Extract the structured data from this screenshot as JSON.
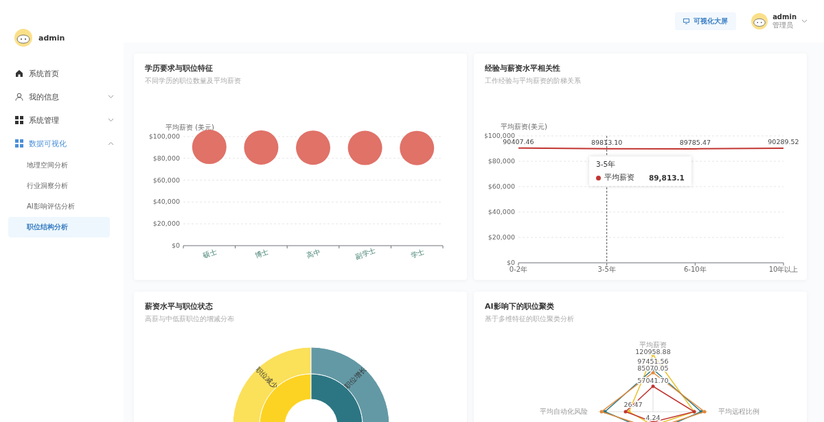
{
  "sidebar": {
    "user": "admin",
    "items": [
      {
        "label": "系统首页",
        "kind": "link",
        "selected": false
      },
      {
        "label": "我的信息",
        "kind": "group",
        "expanded": false,
        "selected": false
      },
      {
        "label": "系统管理",
        "kind": "group",
        "expanded": false,
        "selected": false
      },
      {
        "label": "数据可视化",
        "kind": "group",
        "expanded": true,
        "selected": true,
        "children": [
          {
            "label": "地理空间分析",
            "selected": false
          },
          {
            "label": "行业洞察分析",
            "selected": false
          },
          {
            "label": "AI影响评估分析",
            "selected": false
          },
          {
            "label": "职位结构分析",
            "selected": true
          }
        ]
      }
    ]
  },
  "header": {
    "screen_button": "可视化大屏",
    "user_name": "admin",
    "user_role": "管理员"
  },
  "cards": [
    {
      "title": "学历要求与职位特征",
      "subtitle": "不同学历的职位数量及平均薪资",
      "chart_data": {
        "type": "scatter",
        "ylabel": "平均薪资 (美元)",
        "categories": [
          "硕士",
          "博士",
          "高中",
          "副学士",
          "学士"
        ],
        "grid": true,
        "series": [
          {
            "color": "#de6a60",
            "values": [
              90500,
              90000,
              89800,
              89600,
              89500
            ]
          }
        ],
        "ylim": [
          0,
          100000
        ],
        "yticks": [
          {
            "value": 0,
            "label": "$0"
          },
          {
            "value": 20000,
            "label": "$20,000"
          },
          {
            "value": 40000,
            "label": "$40,000"
          },
          {
            "value": 60000,
            "label": "$60,000"
          },
          {
            "value": 80000,
            "label": "$80,000"
          },
          {
            "value": 100000,
            "label": "$100,000"
          }
        ]
      }
    },
    {
      "title": "经验与薪资水平相关性",
      "subtitle": "工作经验与平均薪资的阶梯关系",
      "chart_data": {
        "type": "line",
        "ylabel": "平均薪资(美元)",
        "categories": [
          "0-2年",
          "3-5年",
          "6-10年",
          "10年以上"
        ],
        "grid": true,
        "series": [
          {
            "color": "#c23531",
            "values": [
              90407.46,
              89813.1,
              89785.47,
              90289.52
            ]
          }
        ],
        "ylim": [
          0,
          100000
        ],
        "yticks": [
          {
            "value": 0,
            "label": "$0"
          },
          {
            "value": 20000,
            "label": "$20,000"
          },
          {
            "value": 40000,
            "label": "$40,000"
          },
          {
            "value": 60000,
            "label": "$60,000"
          },
          {
            "value": 80000,
            "label": "$80,000"
          },
          {
            "value": 100000,
            "label": "$100,000"
          }
        ],
        "value_labels": [
          "90407.46",
          "89813.10",
          "89785.47",
          "90289.52"
        ],
        "ref_lines": [
          {
            "axis": "x",
            "value": "3-5年"
          }
        ]
      },
      "tooltip": {
        "title": "3-5年",
        "name": "平均薪资",
        "value": "89,813.1",
        "color": "#c23531"
      }
    },
    {
      "title": "薪资水平与职位状态",
      "subtitle": "高薪与中低薪职位的增减分布",
      "sunburst": {
        "outer_labels": [
          "职位减少",
          "职位增长"
        ]
      }
    },
    {
      "title": "AI影响下的职位聚类",
      "subtitle": "基于多维特征的职位聚类分析",
      "radar": {
        "axes": [
          "平均薪资",
          "平均自动化风险",
          "平均远程比例"
        ],
        "value_labels": [
          "120958.88",
          "97451.56",
          "85070.05",
          "57041.70",
          "26.47",
          "4.24"
        ]
      }
    }
  ]
}
